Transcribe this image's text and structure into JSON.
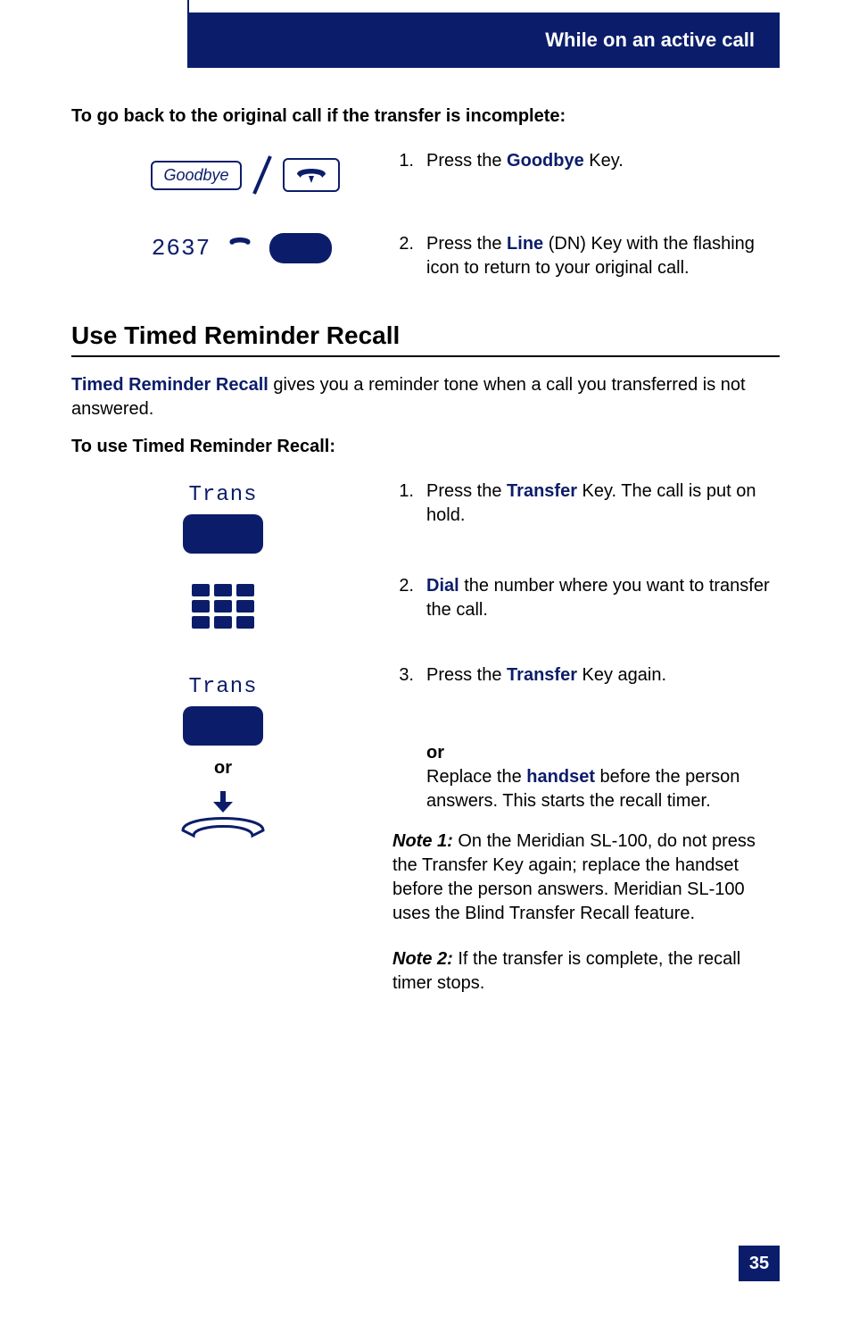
{
  "header": {
    "title": "While on an active call"
  },
  "section1": {
    "heading": "To go back to the original call if the transfer is incomplete:",
    "goodbye_label": "Goodbye",
    "dn_label": "2637",
    "step1": {
      "num": "1.",
      "pre": "Press the ",
      "kw": "Goodbye",
      "post": " Key."
    },
    "step2": {
      "num": "2.",
      "pre": "Press the ",
      "kw": "Line",
      "mid": " (DN) Key with the flashing icon to return to your original call."
    }
  },
  "section2": {
    "title": "Use Timed Reminder Recall",
    "intro_lead": "Timed Reminder Recall",
    "intro_rest": " gives you a reminder tone when a call you transferred is not answered.",
    "sub_heading": "To use Timed Reminder Recall:",
    "trans_label": "Trans",
    "or_label": "or",
    "step1": {
      "num": "1.",
      "pre": "Press the ",
      "kw": "Transfer",
      "post": " Key. The call is put on hold."
    },
    "step2": {
      "num": "2.",
      "kw": "Dial",
      "post": " the number where you want to transfer the call."
    },
    "step3": {
      "num": "3.",
      "pre": "Press the ",
      "kw": "Transfer",
      "post": " Key again."
    },
    "or_right": "or",
    "or_body_pre": "Replace the ",
    "or_body_kw": "handset",
    "or_body_post": " before the person answers. This starts the recall timer.",
    "note1_lead": "Note 1:",
    "note1_body": "  On the Meridian SL-100, do not press the Transfer Key again; replace the handset before the person answers. Meridian SL-100 uses the Blind Transfer Recall feature.",
    "note2_lead": "Note 2:",
    "note2_body": "   If the transfer is complete, the recall timer stops."
  },
  "page_number": "35"
}
